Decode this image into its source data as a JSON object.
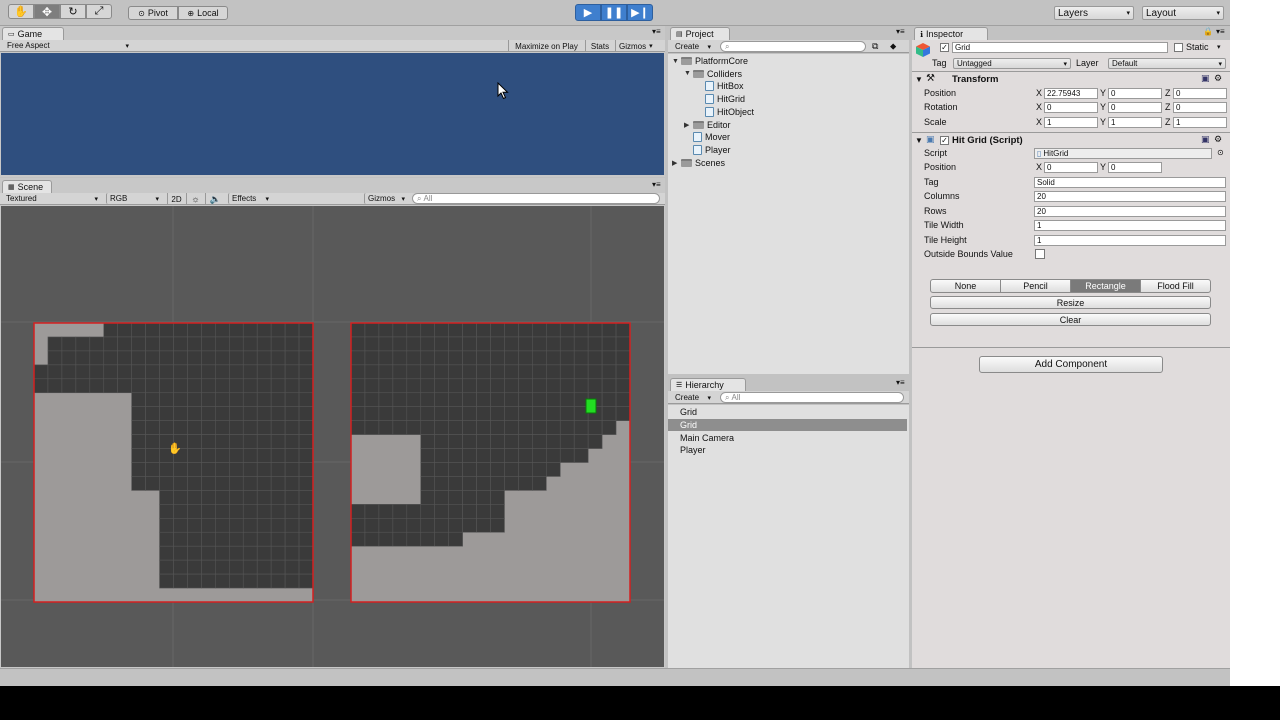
{
  "toolbar": {
    "hand_icon": "hand-icon",
    "pivot_label": "Pivot",
    "local_label": "Local",
    "layers_label": "Layers",
    "layout_label": "Layout"
  },
  "game": {
    "tab_label": "Game",
    "aspect_label": "Free Aspect",
    "maximize_label": "Maximize on Play",
    "stats_label": "Stats",
    "gizmos_label": "Gizmos",
    "bg_color": "#2f4f7f"
  },
  "scene": {
    "tab_label": "Scene",
    "render_mode": "Textured",
    "color_mode": "RGB",
    "mode_2d": "2D",
    "effects_label": "Effects",
    "gizmos_label": "Gizmos",
    "search_placeholder": "All",
    "grid_rows": 20,
    "grid_cols": 20,
    "grid_left": [
      "00000111111111111111",
      "01111111111111111111",
      "01111111111111111111",
      "11111111111111111111",
      "11111111111111111111",
      "00000001111111111111",
      "00000001111111111111",
      "00000001111111111111",
      "00000001111111111111",
      "00000001111111111111",
      "00000001111111111111",
      "00000001111111111111",
      "00000000011111111111",
      "00000000011111111111",
      "00000000011111111111",
      "00000000011111111111",
      "00000000011111111111",
      "00000000011111111111",
      "00000000011111111111",
      "00000000000000000000"
    ],
    "grid_right": [
      "11111111111111111111",
      "11111111111111111111",
      "11111111111111111111",
      "11111111111111111111",
      "11111111111111111111",
      "11111111111111111111",
      "11111111111111111111",
      "11111111111111111110",
      "00000111111111111100",
      "00000111111111111000",
      "00000111111111100000",
      "00000111111111000000",
      "00000111111000000000",
      "11111111111000000000",
      "11111111111000000000",
      "11111111000000000000",
      "00000000000000000000",
      "00000000000000000000",
      "00000000000000000000",
      "00000000000000000000"
    ],
    "player_color": "#22dd22",
    "border_color": "#d42020",
    "cell_dark": "#3a3a3a",
    "cell_light": "#9d9a99"
  },
  "project": {
    "tab_label": "Project",
    "create_label": "Create",
    "items": [
      {
        "label": "PlatformCore",
        "type": "folder",
        "depth": 0,
        "open": true
      },
      {
        "label": "Colliders",
        "type": "folder",
        "depth": 1,
        "open": true
      },
      {
        "label": "HitBox",
        "type": "script",
        "depth": 2
      },
      {
        "label": "HitGrid",
        "type": "script",
        "depth": 2
      },
      {
        "label": "HitObject",
        "type": "script",
        "depth": 2
      },
      {
        "label": "Editor",
        "type": "folder",
        "depth": 1,
        "open": false
      },
      {
        "label": "Mover",
        "type": "script",
        "depth": 1
      },
      {
        "label": "Player",
        "type": "script",
        "depth": 1
      },
      {
        "label": "Scenes",
        "type": "folder",
        "depth": 0,
        "open": false
      }
    ]
  },
  "hierarchy": {
    "tab_label": "Hierarchy",
    "create_label": "Create",
    "search_placeholder": "All",
    "items": [
      "Grid",
      "Grid",
      "Main Camera",
      "Player"
    ],
    "selected_index": 1
  },
  "inspector": {
    "tab_label": "Inspector",
    "object_name": "Grid",
    "static_label": "Static",
    "tag_label": "Tag",
    "tag_value": "Untagged",
    "layer_label": "Layer",
    "layer_value": "Default",
    "transform": {
      "title": "Transform",
      "position_label": "Position",
      "rotation_label": "Rotation",
      "scale_label": "Scale",
      "position": [
        "22.75943",
        "0",
        "0"
      ],
      "rotation": [
        "0",
        "0",
        "0"
      ],
      "scale": [
        "1",
        "1",
        "1"
      ]
    },
    "hitgrid": {
      "title": "Hit Grid (Script)",
      "script_label": "Script",
      "script_value": "HitGrid",
      "position_label": "Position",
      "position": [
        "0",
        "0"
      ],
      "tag_label": "Tag",
      "tag_value": "Solid",
      "columns_label": "Columns",
      "columns_value": "20",
      "rows_label": "Rows",
      "rows_value": "20",
      "tile_width_label": "Tile Width",
      "tile_width_value": "1",
      "tile_height_label": "Tile Height",
      "tile_height_value": "1",
      "outside_label": "Outside Bounds Value",
      "tools": [
        "None",
        "Pencil",
        "Rectangle",
        "Flood Fill"
      ],
      "selected_tool": "Rectangle",
      "resize_label": "Resize",
      "clear_label": "Clear"
    },
    "add_component_label": "Add Component"
  },
  "axis": {
    "x": "X",
    "y": "Y",
    "z": "Z"
  }
}
